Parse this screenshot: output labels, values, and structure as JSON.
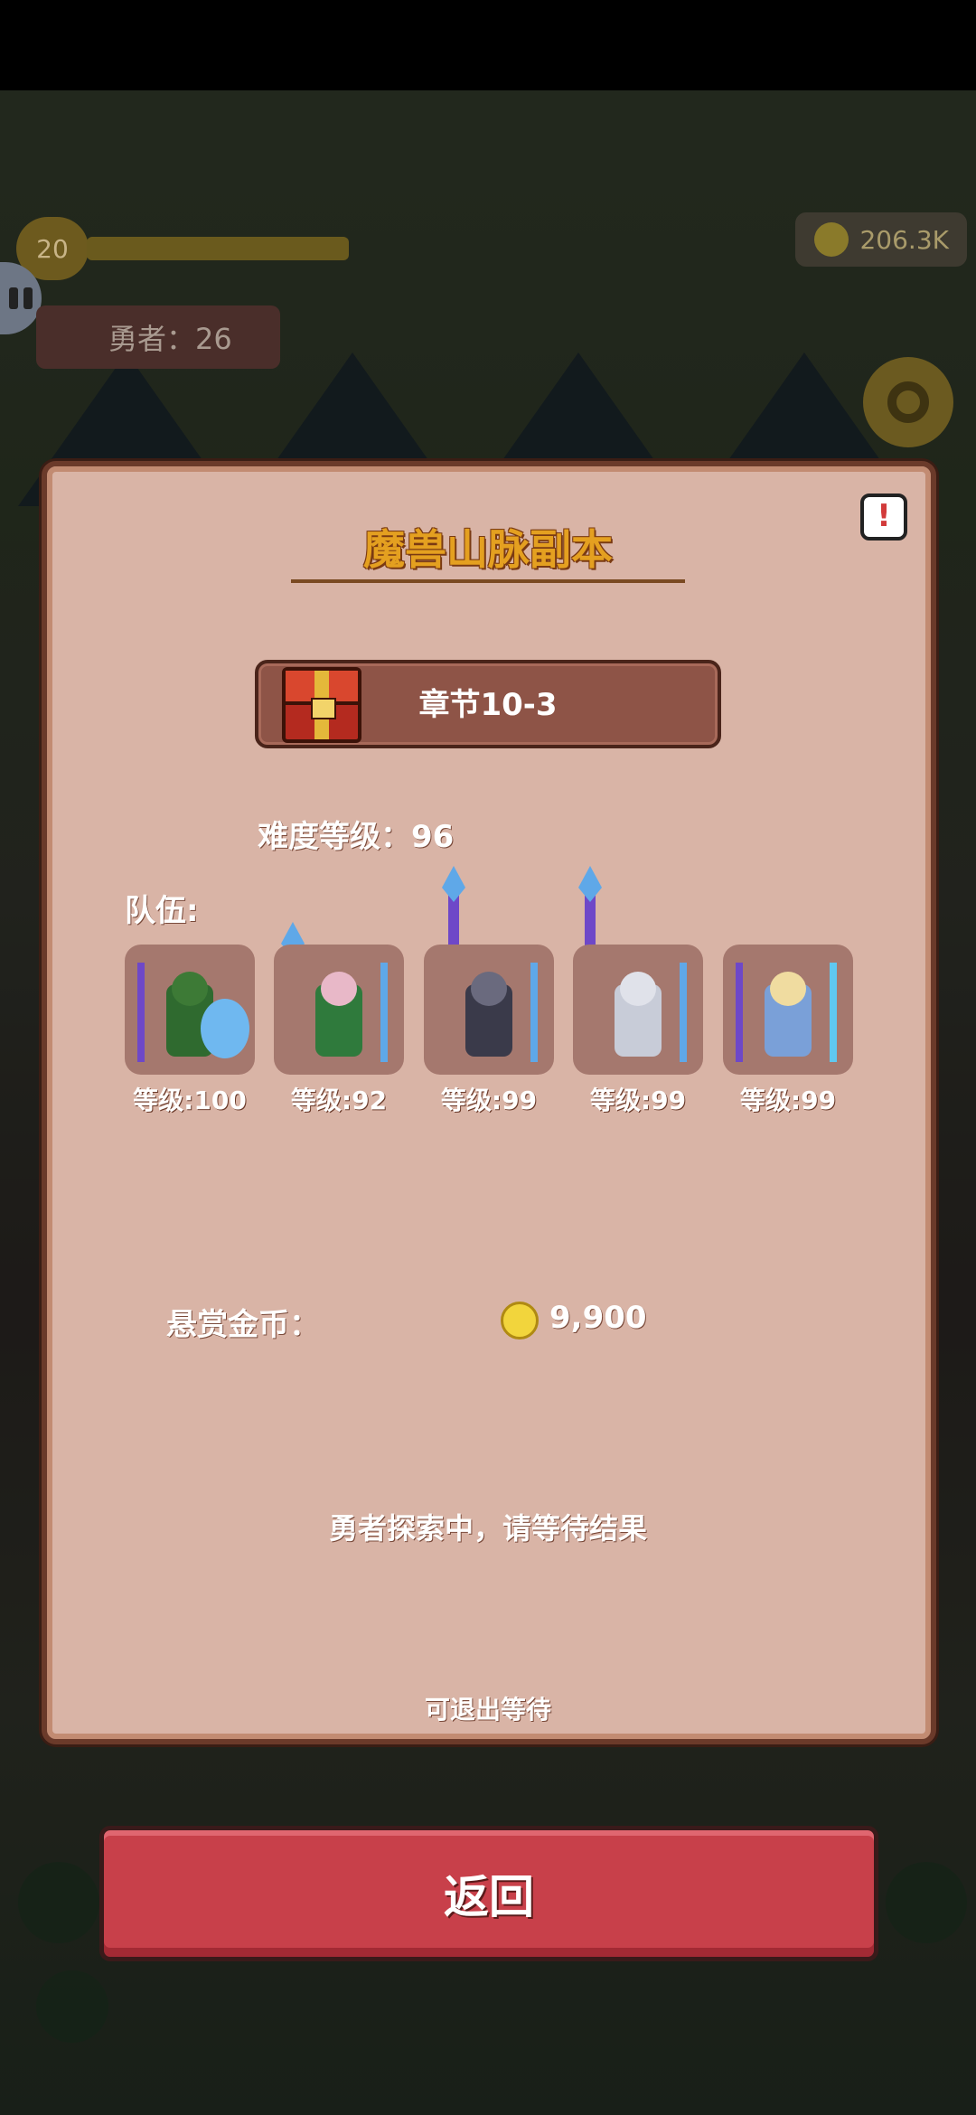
{
  "hud": {
    "player_level": "20",
    "heroes_label": "勇者：26",
    "gold": "206.3K"
  },
  "dialog": {
    "title": "魔兽山脉副本",
    "chapter": "章节10-3",
    "difficulty": "难度等级：96",
    "team_label": "队伍:",
    "heroes": [
      {
        "level": "等级:100",
        "icon": "green-hooded-warrior"
      },
      {
        "level": "等级:92",
        "icon": "deer-druid"
      },
      {
        "level": "等级:99",
        "icon": "helmet-spearman"
      },
      {
        "level": "等级:99",
        "icon": "armored-knight"
      },
      {
        "level": "等级:99",
        "icon": "blonde-archer"
      }
    ],
    "bounty_label": "悬赏金币：",
    "bounty_value": "9,900",
    "status": "勇者探索中，请等待结果",
    "exit_hint": "可退出等待",
    "info_symbol": "!"
  },
  "back_button": "返回",
  "colors": {
    "panel_bg": "#d9b4a6",
    "panel_border": "#6b3a2a",
    "title": "#e4a020",
    "button_red": "#c8404a"
  }
}
